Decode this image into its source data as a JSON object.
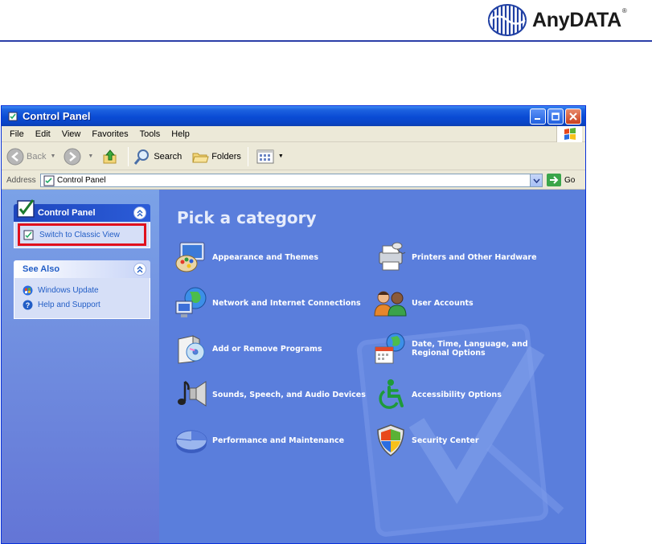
{
  "document": {
    "logo_text": "AnyDATA",
    "logo_mark": "®"
  },
  "window": {
    "title": "Control Panel"
  },
  "menu": {
    "items": [
      "File",
      "Edit",
      "View",
      "Favorites",
      "Tools",
      "Help"
    ]
  },
  "toolbar": {
    "back_label": "Back",
    "search_label": "Search",
    "folders_label": "Folders"
  },
  "address": {
    "label": "Address",
    "value": "Control Panel",
    "go_label": "Go"
  },
  "sidebar": {
    "control_panel_title": "Control Panel",
    "switch_view_label": "Switch to Classic View",
    "see_also_title": "See Also",
    "see_also_links": [
      "Windows Update",
      "Help and Support"
    ]
  },
  "main": {
    "heading": "Pick a category",
    "categories": [
      {
        "label": "Appearance and Themes",
        "icon": "appearance-themes-icon"
      },
      {
        "label": "Printers and Other Hardware",
        "icon": "printers-hardware-icon"
      },
      {
        "label": "Network and Internet Connections",
        "icon": "network-internet-icon"
      },
      {
        "label": "User Accounts",
        "icon": "user-accounts-icon"
      },
      {
        "label": "Add or Remove Programs",
        "icon": "add-remove-programs-icon"
      },
      {
        "label": "Date, Time, Language, and Regional Options",
        "icon": "date-time-language-icon"
      },
      {
        "label": "Sounds, Speech, and Audio Devices",
        "icon": "sounds-audio-icon"
      },
      {
        "label": "Accessibility Options",
        "icon": "accessibility-icon"
      },
      {
        "label": "Performance and Maintenance",
        "icon": "performance-maintenance-icon"
      },
      {
        "label": "Security Center",
        "icon": "security-center-icon"
      }
    ]
  },
  "colors": {
    "titlebar": "#0a4bd4",
    "main_background": "#5a7edc",
    "highlight_box": "#e0101d",
    "link": "#215dc6"
  }
}
